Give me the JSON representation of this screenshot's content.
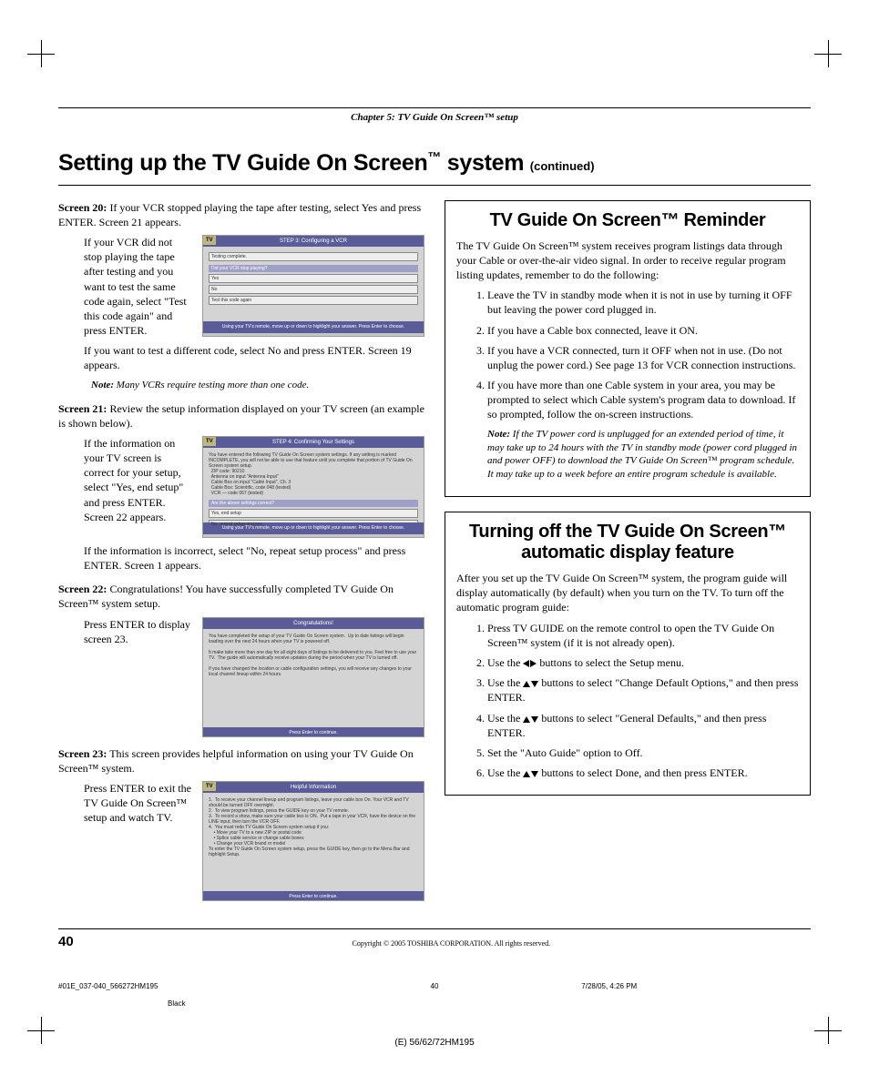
{
  "chapter": "Chapter 5: TV Guide On Screen™ setup",
  "heading": {
    "main": "Setting up the TV Guide On Screen",
    "tm": "™",
    "tail": " system ",
    "cont": "(continued)"
  },
  "s20": {
    "lead": "Screen 20:",
    "head": " If your VCR stopped playing the tape after testing, select Yes and press ENTER. Screen 21 appears.",
    "side": "If your VCR did not stop playing the tape after testing and you want to test the same code again, select \"Test this code again\" and press ENTER.",
    "after": "If you want to test a different code, select No and press ENTER. Screen 19 appears.",
    "note": "Many VCRs require testing more than one code.",
    "ss": {
      "header": "STEP 3: Configuring a VCR",
      "l1": "Testing complete.",
      "q": "Did your VCR stop playing?",
      "o1": "Yes",
      "o2": "No",
      "o3": "Test this code again",
      "footer": "Using your TV's remote, move up or down to highlight your answer.  Press Enter to choose."
    }
  },
  "s21": {
    "lead": "Screen 21:",
    "head": " Review the setup information displayed on your TV screen (an example is shown below).",
    "side": "If the information on your TV screen is correct for your setup, select \"Yes, end setup\" and press ENTER. Screen 22 appears.",
    "after": "If the information is incorrect, select \"No, repeat setup process\" and press ENTER. Screen 1 appears.",
    "ss": {
      "header": "STEP 4: Confirming Your Settings",
      "body": "You have entered the following TV Guide On Screen system settings. If any setting is marked INCOMPLETE, you will not be able to use that feature until you complete that portion of TV Guide On Screen system setup.\n  ZIP code: 90210\n  Antenna on input \"Antenna Input\"\n  Cable Box on input \"Cable Input\", Ch. 3\n  Cable Box: Scientific, code 048 (tested)\n  VCR — code 067 (tested)",
      "q": "Are the above settings correct?",
      "o1": "Yes, end setup",
      "o2": "No, repeat setup process",
      "footer": "Using your TV's remote, move up or down to highlight your answer.  Press Enter to choose."
    }
  },
  "s22": {
    "lead": "Screen 22:",
    "head": " Congratulations! You have successfully completed TV Guide On Screen™ system setup.",
    "side": "Press ENTER to display screen 23.",
    "ss": {
      "header": "Congratulations!",
      "body": "You have completed the setup of your TV Guide On Screen system.  Up to date listings will begin loading over the next 24 hours when your TV is powered off.\n\nIt make take more than one day for all eight days of listings to be delivered to you. Feel free to use your TV.  The guide will automatically receive updates during the period when your TV is turned off.\n\nIf you have changed the location or cable configuration settings, you will receive any changes to your local channel lineup within 24 hours.",
      "footer": "Press Enter to continue."
    }
  },
  "s23": {
    "lead": "Screen 23:",
    "head": " This screen provides helpful information on using your TV Guide On Screen™ system.",
    "side": "Press ENTER to exit the TV Guide On Screen™ setup and watch TV.",
    "ss": {
      "header": "Helpful Information",
      "body": "1.  To receive your channel lineup and program listings, leave your cable box On. Your VCR and TV should be turned OFF overnight.\n2.  To view program listings, press the GUIDE key on your TV remote.\n3.  To record a show, make sure your cable box is ON.  Put a tape in your VCR, have the device on the LINE input, then turn the VCR OFF.\n4.  You must redo TV Guide On Screen system setup if you:\n    • Move your TV to a new ZIP or postal code\n    • Splice cable service or change cable boxes\n    • Change your VCR brand or model\nTo enter the TV Guide On Screen system setup, press the GUIDE key, then go to the Menu Bar and highlight Setup.",
      "footer": "Press Enter to continue."
    }
  },
  "reminder": {
    "title": "TV Guide On Screen™ Reminder",
    "intro": "The TV Guide On Screen™ system receives program listings data through your Cable or over-the-air video signal. In order to receive regular program listing updates, remember to do the following:",
    "items": [
      "Leave the TV in standby mode when it is not in use by turning it OFF but leaving the power cord plugged in.",
      "If you have a Cable box connected, leave it ON.",
      "If you have a VCR connected, turn it OFF when not in use. (Do not unplug the power cord.) See page 13 for VCR connection instructions.",
      "If you have more than one Cable system in your area, you may be prompted to select which Cable system's program data to download. If so prompted, follow the on-screen instructions."
    ],
    "note": "If the TV power cord is unplugged for an extended period of time, it may take up to 24 hours with the TV in standby mode (power cord plugged in and power OFF) to download the TV Guide On Screen™ program schedule. It may take up to a week before an entire program schedule is available."
  },
  "turnoff": {
    "title": "Turning off the TV Guide On Screen™ automatic display feature",
    "intro": "After you set up the TV Guide On Screen™ system, the program guide will display automatically (by default) when you turn on the TV. To turn off the automatic program guide:",
    "items": [
      "Press TV GUIDE on the remote control to open the TV Guide On Screen™ system (if it is not already open).",
      "Use the ◀▶ buttons to select the Setup menu.",
      "Use the ▲▼ buttons to select \"Change Default Options,\" and then press ENTER.",
      "Use the ▲▼ buttons to select \"General Defaults,\" and then press ENTER.",
      "Set the \"Auto Guide\" option to Off.",
      "Use the ▲▼ buttons to select Done, and then press ENTER."
    ]
  },
  "pagefoot": {
    "num": "40",
    "copyright": "Copyright © 2005 TOSHIBA CORPORATION. All rights reserved."
  },
  "marks": {
    "file": "#01E_037-040_566272HM195",
    "page": "40",
    "date": "7/28/05, 4:26 PM",
    "black": "Black",
    "model": "(E) 56/62/72HM195"
  },
  "note_label": "Note:"
}
